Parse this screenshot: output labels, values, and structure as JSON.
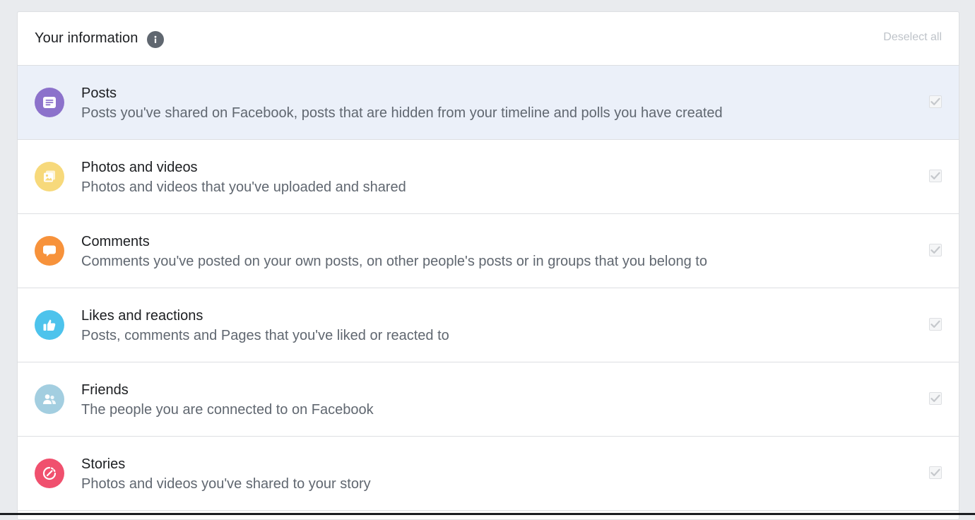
{
  "header": {
    "title": "Your information",
    "deselect_label": "Deselect all"
  },
  "colors": {
    "posts": "#8c72cb",
    "photos": "#f7d97b",
    "comments": "#f7923b",
    "likes": "#4dc3ec",
    "friends": "#a3cee0",
    "stories": "#f0506e",
    "selected_row_bg": "#ebf0f9"
  },
  "items": [
    {
      "icon": "posts-icon",
      "title": "Posts",
      "description": "Posts you've shared on Facebook, posts that are hidden from your timeline and polls you have created",
      "checked": true,
      "highlighted": true
    },
    {
      "icon": "photos-icon",
      "title": "Photos and videos",
      "description": "Photos and videos that you've uploaded and shared",
      "checked": true,
      "highlighted": false
    },
    {
      "icon": "comments-icon",
      "title": "Comments",
      "description": "Comments you've posted on your own posts, on other people's posts or in groups that you belong to",
      "checked": true,
      "highlighted": false
    },
    {
      "icon": "thumbs-up-icon",
      "title": "Likes and reactions",
      "description": "Posts, comments and Pages that you've liked or reacted to",
      "checked": true,
      "highlighted": false
    },
    {
      "icon": "friends-icon",
      "title": "Friends",
      "description": "The people you are connected to on Facebook",
      "checked": true,
      "highlighted": false
    },
    {
      "icon": "stories-icon",
      "title": "Stories",
      "description": "Photos and videos you've shared to your story",
      "checked": true,
      "highlighted": false
    }
  ]
}
